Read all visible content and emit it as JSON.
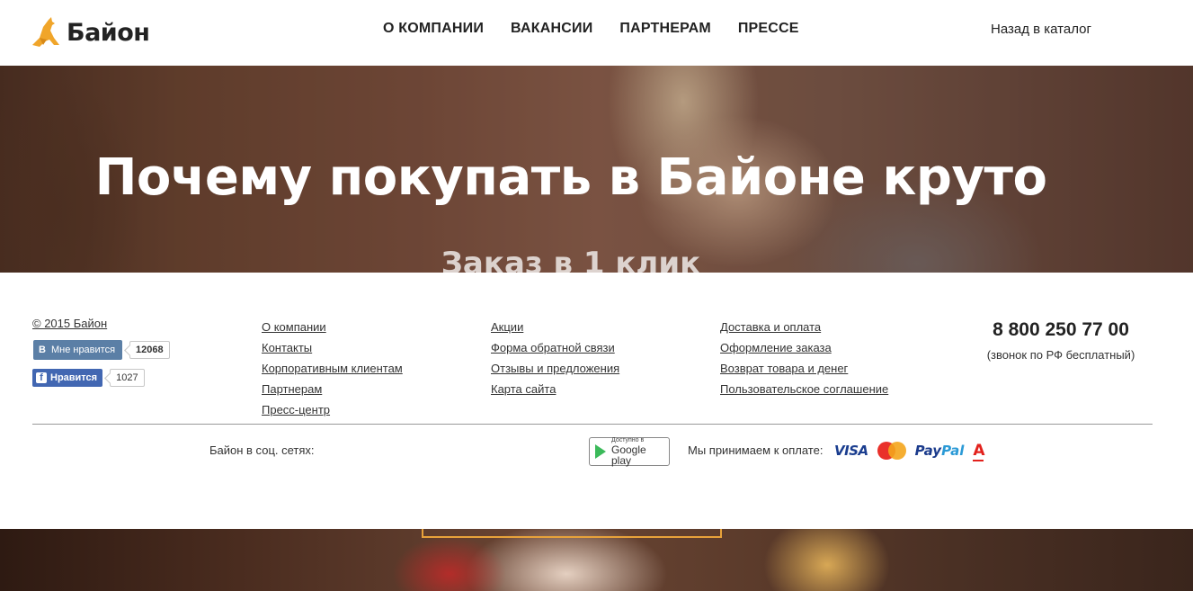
{
  "header": {
    "logo_text": "Байон",
    "nav": [
      "О КОМПАНИИ",
      "ВАКАНСИИ",
      "ПАРТНЕРАМ",
      "ПРЕССЕ"
    ],
    "back_link": "Назад в каталог"
  },
  "hero": {
    "title": "Почему покупать в Байоне круто",
    "subtitle": "Заказ в 1 клик"
  },
  "footer": {
    "copyright": "© 2015 Байон",
    "vk": {
      "label": "Мне нравится",
      "letter": "В",
      "count": "12068"
    },
    "fb": {
      "label": "Нравится",
      "letter": "f",
      "count": "1027"
    },
    "col1": [
      "О компании",
      "Контакты",
      "Корпоративным клиентам",
      "Партнерам",
      "Пресс-центр"
    ],
    "col2": [
      "Акции",
      "Форма обратной связи",
      "Отзывы и предложения",
      "Карта сайта"
    ],
    "col3": [
      "Доставка и оплата",
      "Оформление заказа",
      "Возврат товара и денег",
      "Пользовательское соглашение"
    ],
    "phone": "8 800 250 77 00",
    "phone_note": "(звонок по РФ бесплатный)",
    "social_label": "Байон в соц. сетях:",
    "google_play": {
      "small": "Доступно в",
      "big": "Google play"
    },
    "payment_label": "Мы принимаем к оплате:",
    "payment": {
      "visa": "VISA",
      "paypal_a": "Pay",
      "paypal_b": "Pal",
      "alfa": "А"
    }
  },
  "colors": {
    "accent_orange": "#e8a23a",
    "vk_blue": "#5b7fa6",
    "fb_blue": "#4267b2"
  }
}
